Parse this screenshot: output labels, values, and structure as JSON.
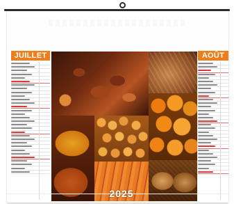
{
  "calendar": {
    "left_month": "JUILLET",
    "right_month": "AOÛT",
    "year": "2025",
    "accent_color": "#ee7e1c",
    "sunday_color": "#d63a3a",
    "left_days": 31,
    "right_days": 31,
    "left_sundays": [
      6,
      13,
      20,
      27
    ],
    "right_sundays": [
      3,
      10,
      17,
      24,
      31
    ]
  },
  "photos": {
    "top_left": "dried-fruit-dates-photo",
    "top_right": "wicker-basket-photo",
    "middle_right": "oranges-photo",
    "middle_center": "apricots-photo",
    "bottom_left": "spice-mounds-photo",
    "bottom_center": "carrots-photo",
    "bottom_right": "baskets-photo"
  }
}
